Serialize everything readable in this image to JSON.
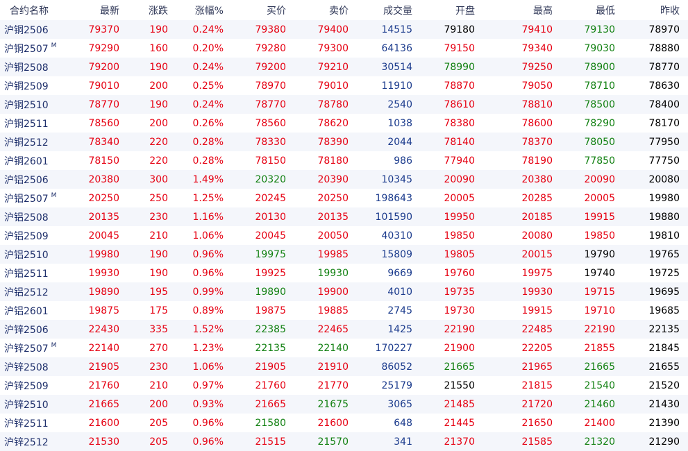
{
  "colors": {
    "up": "#e60012",
    "down": "#118011",
    "volume": "#1a3a8c",
    "flat": "#000000",
    "name": "#1e2f6b"
  },
  "headers": [
    "合约名称",
    "最新",
    "涨跌",
    "涨幅%",
    "买价",
    "卖价",
    "成交量",
    "开盘",
    "最高",
    "最低",
    "昨收"
  ],
  "rows": [
    {
      "name": "沪铜2506",
      "main": "",
      "cells": [
        {
          "v": "79370",
          "c": "red"
        },
        {
          "v": "190",
          "c": "red"
        },
        {
          "v": "0.24%",
          "c": "red"
        },
        {
          "v": "79380",
          "c": "red"
        },
        {
          "v": "79400",
          "c": "red"
        },
        {
          "v": "14515",
          "c": "blue"
        },
        {
          "v": "79180",
          "c": "black"
        },
        {
          "v": "79410",
          "c": "red"
        },
        {
          "v": "79130",
          "c": "green"
        },
        {
          "v": "78970",
          "c": "black"
        }
      ]
    },
    {
      "name": "沪铜2507",
      "main": "M",
      "cells": [
        {
          "v": "79290",
          "c": "red"
        },
        {
          "v": "160",
          "c": "red"
        },
        {
          "v": "0.20%",
          "c": "red"
        },
        {
          "v": "79280",
          "c": "red"
        },
        {
          "v": "79300",
          "c": "red"
        },
        {
          "v": "64136",
          "c": "blue"
        },
        {
          "v": "79150",
          "c": "red"
        },
        {
          "v": "79340",
          "c": "red"
        },
        {
          "v": "79030",
          "c": "green"
        },
        {
          "v": "78880",
          "c": "black"
        }
      ]
    },
    {
      "name": "沪铜2508",
      "main": "",
      "cells": [
        {
          "v": "79200",
          "c": "red"
        },
        {
          "v": "190",
          "c": "red"
        },
        {
          "v": "0.24%",
          "c": "red"
        },
        {
          "v": "79200",
          "c": "red"
        },
        {
          "v": "79210",
          "c": "red"
        },
        {
          "v": "30514",
          "c": "blue"
        },
        {
          "v": "78990",
          "c": "green"
        },
        {
          "v": "79250",
          "c": "red"
        },
        {
          "v": "78900",
          "c": "green"
        },
        {
          "v": "78770",
          "c": "black"
        }
      ]
    },
    {
      "name": "沪铜2509",
      "main": "",
      "cells": [
        {
          "v": "79010",
          "c": "red"
        },
        {
          "v": "200",
          "c": "red"
        },
        {
          "v": "0.25%",
          "c": "red"
        },
        {
          "v": "78970",
          "c": "red"
        },
        {
          "v": "79010",
          "c": "red"
        },
        {
          "v": "11910",
          "c": "blue"
        },
        {
          "v": "78870",
          "c": "red"
        },
        {
          "v": "79050",
          "c": "red"
        },
        {
          "v": "78710",
          "c": "green"
        },
        {
          "v": "78630",
          "c": "black"
        }
      ]
    },
    {
      "name": "沪铜2510",
      "main": "",
      "cells": [
        {
          "v": "78770",
          "c": "red"
        },
        {
          "v": "190",
          "c": "red"
        },
        {
          "v": "0.24%",
          "c": "red"
        },
        {
          "v": "78770",
          "c": "red"
        },
        {
          "v": "78780",
          "c": "red"
        },
        {
          "v": "2540",
          "c": "blue"
        },
        {
          "v": "78610",
          "c": "red"
        },
        {
          "v": "78810",
          "c": "red"
        },
        {
          "v": "78500",
          "c": "green"
        },
        {
          "v": "78400",
          "c": "black"
        }
      ]
    },
    {
      "name": "沪铜2511",
      "main": "",
      "cells": [
        {
          "v": "78560",
          "c": "red"
        },
        {
          "v": "200",
          "c": "red"
        },
        {
          "v": "0.26%",
          "c": "red"
        },
        {
          "v": "78560",
          "c": "red"
        },
        {
          "v": "78620",
          "c": "red"
        },
        {
          "v": "1038",
          "c": "blue"
        },
        {
          "v": "78380",
          "c": "red"
        },
        {
          "v": "78600",
          "c": "red"
        },
        {
          "v": "78290",
          "c": "green"
        },
        {
          "v": "78170",
          "c": "black"
        }
      ]
    },
    {
      "name": "沪铜2512",
      "main": "",
      "cells": [
        {
          "v": "78340",
          "c": "red"
        },
        {
          "v": "220",
          "c": "red"
        },
        {
          "v": "0.28%",
          "c": "red"
        },
        {
          "v": "78330",
          "c": "red"
        },
        {
          "v": "78390",
          "c": "red"
        },
        {
          "v": "2044",
          "c": "blue"
        },
        {
          "v": "78140",
          "c": "red"
        },
        {
          "v": "78370",
          "c": "red"
        },
        {
          "v": "78050",
          "c": "green"
        },
        {
          "v": "77950",
          "c": "black"
        }
      ]
    },
    {
      "name": "沪铜2601",
      "main": "",
      "cells": [
        {
          "v": "78150",
          "c": "red"
        },
        {
          "v": "220",
          "c": "red"
        },
        {
          "v": "0.28%",
          "c": "red"
        },
        {
          "v": "78150",
          "c": "red"
        },
        {
          "v": "78180",
          "c": "red"
        },
        {
          "v": "986",
          "c": "blue"
        },
        {
          "v": "77940",
          "c": "red"
        },
        {
          "v": "78190",
          "c": "red"
        },
        {
          "v": "77850",
          "c": "green"
        },
        {
          "v": "77750",
          "c": "black"
        }
      ]
    },
    {
      "name": "沪铝2506",
      "main": "",
      "cells": [
        {
          "v": "20380",
          "c": "red"
        },
        {
          "v": "300",
          "c": "red"
        },
        {
          "v": "1.49%",
          "c": "red"
        },
        {
          "v": "20320",
          "c": "green"
        },
        {
          "v": "20390",
          "c": "red"
        },
        {
          "v": "10345",
          "c": "blue"
        },
        {
          "v": "20090",
          "c": "red"
        },
        {
          "v": "20380",
          "c": "red"
        },
        {
          "v": "20090",
          "c": "red"
        },
        {
          "v": "20080",
          "c": "black"
        }
      ]
    },
    {
      "name": "沪铝2507",
      "main": "M",
      "cells": [
        {
          "v": "20250",
          "c": "red"
        },
        {
          "v": "250",
          "c": "red"
        },
        {
          "v": "1.25%",
          "c": "red"
        },
        {
          "v": "20245",
          "c": "red"
        },
        {
          "v": "20250",
          "c": "red"
        },
        {
          "v": "198643",
          "c": "blue"
        },
        {
          "v": "20005",
          "c": "red"
        },
        {
          "v": "20285",
          "c": "red"
        },
        {
          "v": "20005",
          "c": "red"
        },
        {
          "v": "19980",
          "c": "black"
        }
      ]
    },
    {
      "name": "沪铝2508",
      "main": "",
      "cells": [
        {
          "v": "20135",
          "c": "red"
        },
        {
          "v": "230",
          "c": "red"
        },
        {
          "v": "1.16%",
          "c": "red"
        },
        {
          "v": "20130",
          "c": "red"
        },
        {
          "v": "20135",
          "c": "red"
        },
        {
          "v": "101590",
          "c": "blue"
        },
        {
          "v": "19950",
          "c": "red"
        },
        {
          "v": "20185",
          "c": "red"
        },
        {
          "v": "19915",
          "c": "red"
        },
        {
          "v": "19880",
          "c": "black"
        }
      ]
    },
    {
      "name": "沪铝2509",
      "main": "",
      "cells": [
        {
          "v": "20045",
          "c": "red"
        },
        {
          "v": "210",
          "c": "red"
        },
        {
          "v": "1.06%",
          "c": "red"
        },
        {
          "v": "20045",
          "c": "red"
        },
        {
          "v": "20050",
          "c": "red"
        },
        {
          "v": "40310",
          "c": "blue"
        },
        {
          "v": "19850",
          "c": "red"
        },
        {
          "v": "20080",
          "c": "red"
        },
        {
          "v": "19850",
          "c": "red"
        },
        {
          "v": "19810",
          "c": "black"
        }
      ]
    },
    {
      "name": "沪铝2510",
      "main": "",
      "cells": [
        {
          "v": "19980",
          "c": "red"
        },
        {
          "v": "190",
          "c": "red"
        },
        {
          "v": "0.96%",
          "c": "red"
        },
        {
          "v": "19975",
          "c": "green"
        },
        {
          "v": "19985",
          "c": "red"
        },
        {
          "v": "15809",
          "c": "blue"
        },
        {
          "v": "19805",
          "c": "red"
        },
        {
          "v": "20015",
          "c": "red"
        },
        {
          "v": "19790",
          "c": "black"
        },
        {
          "v": "19765",
          "c": "black"
        }
      ]
    },
    {
      "name": "沪铝2511",
      "main": "",
      "cells": [
        {
          "v": "19930",
          "c": "red"
        },
        {
          "v": "190",
          "c": "red"
        },
        {
          "v": "0.96%",
          "c": "red"
        },
        {
          "v": "19925",
          "c": "red"
        },
        {
          "v": "19930",
          "c": "green"
        },
        {
          "v": "9669",
          "c": "blue"
        },
        {
          "v": "19760",
          "c": "red"
        },
        {
          "v": "19975",
          "c": "red"
        },
        {
          "v": "19740",
          "c": "black"
        },
        {
          "v": "19725",
          "c": "black"
        }
      ]
    },
    {
      "name": "沪铝2512",
      "main": "",
      "cells": [
        {
          "v": "19890",
          "c": "red"
        },
        {
          "v": "195",
          "c": "red"
        },
        {
          "v": "0.99%",
          "c": "red"
        },
        {
          "v": "19890",
          "c": "green"
        },
        {
          "v": "19900",
          "c": "red"
        },
        {
          "v": "4010",
          "c": "blue"
        },
        {
          "v": "19735",
          "c": "red"
        },
        {
          "v": "19930",
          "c": "red"
        },
        {
          "v": "19715",
          "c": "red"
        },
        {
          "v": "19695",
          "c": "black"
        }
      ]
    },
    {
      "name": "沪铝2601",
      "main": "",
      "cells": [
        {
          "v": "19875",
          "c": "red"
        },
        {
          "v": "175",
          "c": "red"
        },
        {
          "v": "0.89%",
          "c": "red"
        },
        {
          "v": "19875",
          "c": "red"
        },
        {
          "v": "19885",
          "c": "red"
        },
        {
          "v": "2745",
          "c": "blue"
        },
        {
          "v": "19730",
          "c": "red"
        },
        {
          "v": "19915",
          "c": "red"
        },
        {
          "v": "19710",
          "c": "red"
        },
        {
          "v": "19685",
          "c": "black"
        }
      ]
    },
    {
      "name": "沪锌2506",
      "main": "",
      "cells": [
        {
          "v": "22430",
          "c": "red"
        },
        {
          "v": "335",
          "c": "red"
        },
        {
          "v": "1.52%",
          "c": "red"
        },
        {
          "v": "22385",
          "c": "green"
        },
        {
          "v": "22465",
          "c": "red"
        },
        {
          "v": "1425",
          "c": "blue"
        },
        {
          "v": "22190",
          "c": "red"
        },
        {
          "v": "22485",
          "c": "red"
        },
        {
          "v": "22190",
          "c": "red"
        },
        {
          "v": "22135",
          "c": "black"
        }
      ]
    },
    {
      "name": "沪锌2507",
      "main": "M",
      "cells": [
        {
          "v": "22140",
          "c": "red"
        },
        {
          "v": "270",
          "c": "red"
        },
        {
          "v": "1.23%",
          "c": "red"
        },
        {
          "v": "22135",
          "c": "green"
        },
        {
          "v": "22140",
          "c": "green"
        },
        {
          "v": "170227",
          "c": "blue"
        },
        {
          "v": "21900",
          "c": "red"
        },
        {
          "v": "22205",
          "c": "red"
        },
        {
          "v": "21855",
          "c": "red"
        },
        {
          "v": "21845",
          "c": "black"
        }
      ]
    },
    {
      "name": "沪锌2508",
      "main": "",
      "cells": [
        {
          "v": "21905",
          "c": "red"
        },
        {
          "v": "230",
          "c": "red"
        },
        {
          "v": "1.06%",
          "c": "red"
        },
        {
          "v": "21905",
          "c": "red"
        },
        {
          "v": "21910",
          "c": "red"
        },
        {
          "v": "86052",
          "c": "blue"
        },
        {
          "v": "21665",
          "c": "green"
        },
        {
          "v": "21965",
          "c": "red"
        },
        {
          "v": "21665",
          "c": "green"
        },
        {
          "v": "21655",
          "c": "black"
        }
      ]
    },
    {
      "name": "沪锌2509",
      "main": "",
      "cells": [
        {
          "v": "21760",
          "c": "red"
        },
        {
          "v": "210",
          "c": "red"
        },
        {
          "v": "0.97%",
          "c": "red"
        },
        {
          "v": "21760",
          "c": "red"
        },
        {
          "v": "21770",
          "c": "red"
        },
        {
          "v": "25179",
          "c": "blue"
        },
        {
          "v": "21550",
          "c": "black"
        },
        {
          "v": "21815",
          "c": "red"
        },
        {
          "v": "21540",
          "c": "green"
        },
        {
          "v": "21520",
          "c": "black"
        }
      ]
    },
    {
      "name": "沪锌2510",
      "main": "",
      "cells": [
        {
          "v": "21665",
          "c": "red"
        },
        {
          "v": "200",
          "c": "red"
        },
        {
          "v": "0.93%",
          "c": "red"
        },
        {
          "v": "21665",
          "c": "red"
        },
        {
          "v": "21675",
          "c": "green"
        },
        {
          "v": "3065",
          "c": "blue"
        },
        {
          "v": "21485",
          "c": "red"
        },
        {
          "v": "21720",
          "c": "red"
        },
        {
          "v": "21460",
          "c": "green"
        },
        {
          "v": "21430",
          "c": "black"
        }
      ]
    },
    {
      "name": "沪锌2511",
      "main": "",
      "cells": [
        {
          "v": "21600",
          "c": "red"
        },
        {
          "v": "205",
          "c": "red"
        },
        {
          "v": "0.96%",
          "c": "red"
        },
        {
          "v": "21580",
          "c": "green"
        },
        {
          "v": "21600",
          "c": "red"
        },
        {
          "v": "648",
          "c": "blue"
        },
        {
          "v": "21445",
          "c": "red"
        },
        {
          "v": "21650",
          "c": "red"
        },
        {
          "v": "21400",
          "c": "red"
        },
        {
          "v": "21390",
          "c": "black"
        }
      ]
    },
    {
      "name": "沪锌2512",
      "main": "",
      "cells": [
        {
          "v": "21530",
          "c": "red"
        },
        {
          "v": "205",
          "c": "red"
        },
        {
          "v": "0.96%",
          "c": "red"
        },
        {
          "v": "21515",
          "c": "red"
        },
        {
          "v": "21570",
          "c": "green"
        },
        {
          "v": "341",
          "c": "blue"
        },
        {
          "v": "21370",
          "c": "red"
        },
        {
          "v": "21585",
          "c": "red"
        },
        {
          "v": "21320",
          "c": "green"
        },
        {
          "v": "21290",
          "c": "black"
        }
      ]
    }
  ]
}
